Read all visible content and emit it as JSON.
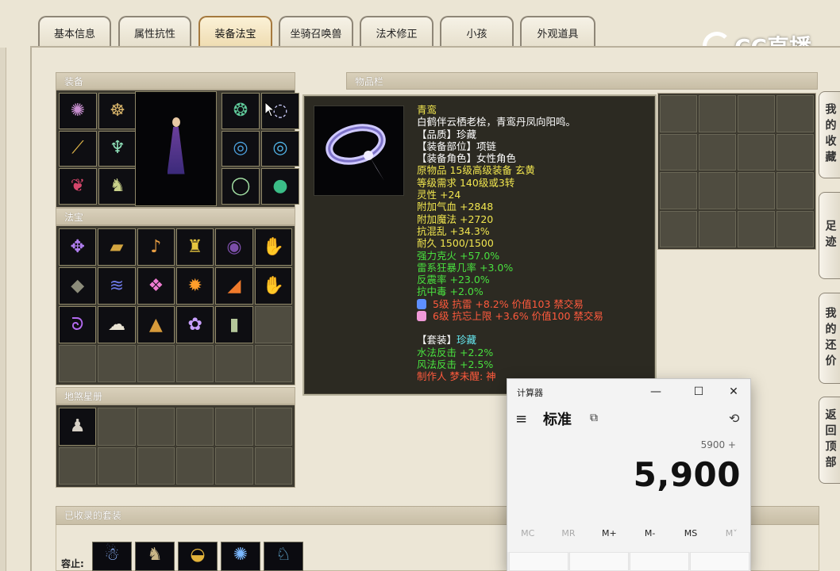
{
  "tabs": [
    {
      "label": "基本信息",
      "active": false
    },
    {
      "label": "属性抗性",
      "active": false
    },
    {
      "label": "装备法宝",
      "active": true
    },
    {
      "label": "坐骑召唤兽",
      "active": false
    },
    {
      "label": "法术修正",
      "active": false
    },
    {
      "label": "小孩",
      "active": false
    },
    {
      "label": "外观道具",
      "active": false
    }
  ],
  "brand": {
    "logo_text": "CC直播"
  },
  "panels": {
    "equipment": "装备",
    "treasure": "法宝",
    "star_book": "地煞星册",
    "inventory": "物品栏",
    "collected_sets": "已收录的套装",
    "sets_label": "容止:"
  },
  "tooltip": {
    "name": "青鸾",
    "desc": "白鹤伴云栖老桧，青鸾丹凤向阳鸣。",
    "quality": "【品质】珍藏",
    "slot": "【装备部位】项链",
    "role": "【装备角色】女性角色",
    "origin": "原物品 15级高级装备 玄黄",
    "req": "等级需求 140级或3转",
    "stats_yellow": [
      "灵性 +24",
      "附加气血 +2848",
      "附加魔法 +2720",
      "抗混乱 +34.3%",
      "耐久 1500/1500"
    ],
    "stats_green": [
      "强力克火 +57.0%",
      "雷系狂暴几率 +3.0%",
      "反震率 +23.0%",
      "抗中毒 +2.0%"
    ],
    "gems": [
      {
        "text": "5级 抗雷 +8.2% 价值103 禁交易",
        "color": "#5e8fff"
      },
      {
        "text": "6级 抗忘上限 +3.6% 价值100 禁交易",
        "color": "#f09ad8"
      }
    ],
    "set_prefix": "【套装】",
    "set_name": "珍藏",
    "set_stats": [
      "水法反击 +2.2%",
      "风法反击 +2.5%"
    ],
    "maker": "制作人 梦未醒: 神"
  },
  "side_tabs": [
    "我的收藏",
    "足迹",
    "我的还价",
    "返回顶部"
  ],
  "calculator": {
    "title": "计算器",
    "mode": "标准",
    "expression": "5900 +",
    "display": "5,900",
    "memory_keys": [
      "MC",
      "MR",
      "M+",
      "M-",
      "MS",
      "M˅"
    ],
    "window_controls": {
      "minimize": "—",
      "maximize": "☐",
      "close": "✕"
    }
  },
  "icons": {
    "equipment": [
      {
        "name": "octopus-helm-icon",
        "glyph": "✺",
        "color": "#c88fd0"
      },
      {
        "name": "gold-skull-icon",
        "glyph": "☸",
        "color": "#d8b46a"
      },
      {
        "name": "green-mask-icon",
        "glyph": "❂",
        "color": "#5fc99a"
      },
      {
        "name": "silver-ring-icon",
        "glyph": "◌",
        "color": "#cfd0ff"
      },
      {
        "name": "golden-staff-icon",
        "glyph": "⟋",
        "color": "#e2b84a"
      },
      {
        "name": "green-robe-icon",
        "glyph": "♆",
        "color": "#8fe0b8"
      },
      {
        "name": "blue-bracelet-icon",
        "glyph": "◎",
        "color": "#4da3e0"
      },
      {
        "name": "blue-bracelet-2-icon",
        "glyph": "◎",
        "color": "#52b6ea"
      },
      {
        "name": "red-flame-necklace-icon",
        "glyph": "❦",
        "color": "#d5466b"
      },
      {
        "name": "boots-icon",
        "glyph": "♞",
        "color": "#c8d08a"
      },
      {
        "name": "jade-necklace-icon",
        "glyph": "◯",
        "color": "#a7e6a8"
      },
      {
        "name": "green-orb-icon",
        "glyph": "●",
        "color": "#3bbd87"
      }
    ],
    "treasure": [
      {
        "name": "purple-fan-icon",
        "glyph": "✥",
        "color": "#b07ef0"
      },
      {
        "name": "gold-scroll-icon",
        "glyph": "▰",
        "color": "#d4a640"
      },
      {
        "name": "lute-icon",
        "glyph": "♪",
        "color": "#e79d42"
      },
      {
        "name": "gold-pagoda-icon",
        "glyph": "♜",
        "color": "#e5c53f"
      },
      {
        "name": "dark-portal-icon",
        "glyph": "◉",
        "color": "#7b4ea9"
      },
      {
        "name": "blue-claw-icon",
        "glyph": "✋",
        "color": "#7ca9ff"
      },
      {
        "name": "iron-plate-icon",
        "glyph": "◆",
        "color": "#8c8c7a"
      },
      {
        "name": "blue-cloth-icon",
        "glyph": "≋",
        "color": "#6c78e6"
      },
      {
        "name": "pink-lantern-icon",
        "glyph": "❖",
        "color": "#ee7bd1"
      },
      {
        "name": "fire-orb-icon",
        "glyph": "✹",
        "color": "#ff9d2b"
      },
      {
        "name": "fire-shard-icon",
        "glyph": "◢",
        "color": "#f07a2b"
      },
      {
        "name": "ice-claw-icon",
        "glyph": "✋",
        "color": "#a9c7ff"
      },
      {
        "name": "purple-whip-icon",
        "glyph": "ᘐ",
        "color": "#b36af0"
      },
      {
        "name": "white-tiger-icon",
        "glyph": "☁",
        "color": "#e9e3d3"
      },
      {
        "name": "gold-mountain-icon",
        "glyph": "▲",
        "color": "#d69a3a"
      },
      {
        "name": "purple-flower-icon",
        "glyph": "✿",
        "color": "#c9a0ff"
      },
      {
        "name": "jade-tablet-icon",
        "glyph": "▮",
        "color": "#b5c79a"
      }
    ],
    "star_book": [
      {
        "name": "warrior-portrait-icon",
        "glyph": "♟",
        "color": "#d6d0c6"
      }
    ],
    "sets": [
      {
        "name": "set-ghost-icon",
        "glyph": "☃",
        "color": "#8fb6ff"
      },
      {
        "name": "set-warrior-icon",
        "glyph": "♞",
        "color": "#c9b587"
      },
      {
        "name": "set-gold-bowl-icon",
        "glyph": "◒",
        "color": "#e3b33b"
      },
      {
        "name": "set-blue-beast-icon",
        "glyph": "✺",
        "color": "#7bb8ff"
      },
      {
        "name": "set-blue-fox-icon",
        "glyph": "♘",
        "color": "#69b6e0"
      }
    ]
  }
}
